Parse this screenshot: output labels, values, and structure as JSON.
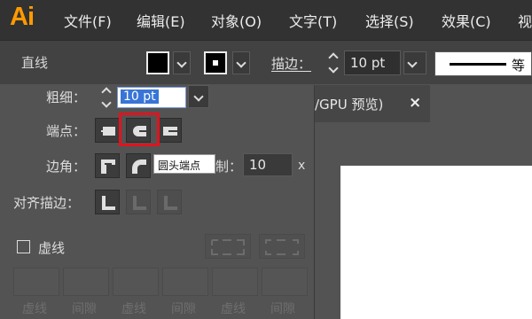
{
  "app": {
    "logo": "Ai"
  },
  "menu": [
    "文件(F)",
    "编辑(E)",
    "对象(O)",
    "文字(T)",
    "选择(S)",
    "效果(C)",
    "视"
  ],
  "control_bar": {
    "tool_name": "直线",
    "stroke_label": "描边：",
    "stroke_value": "10 pt",
    "line_style_label": "等"
  },
  "document_tab": {
    "title": "/GPU 预览)",
    "close": "×"
  },
  "stroke_panel": {
    "weight_label": "粗细：",
    "weight_value": "10 pt",
    "cap_label": "端点：",
    "corner_label": "边角：",
    "limit_label": "限制：",
    "limit_value": "10",
    "limit_unit": "x",
    "align_label": "对齐描边：",
    "dashed_label": "虚线",
    "dashed_checked": false,
    "tooltip": "圆头端点",
    "dash_labels": [
      "虚线",
      "间隙",
      "虚线",
      "间隙",
      "虚线",
      "间隙"
    ]
  },
  "colors": {
    "highlight": "#e0141e",
    "selection": "#3875d7",
    "logo": "#ff9a00"
  }
}
